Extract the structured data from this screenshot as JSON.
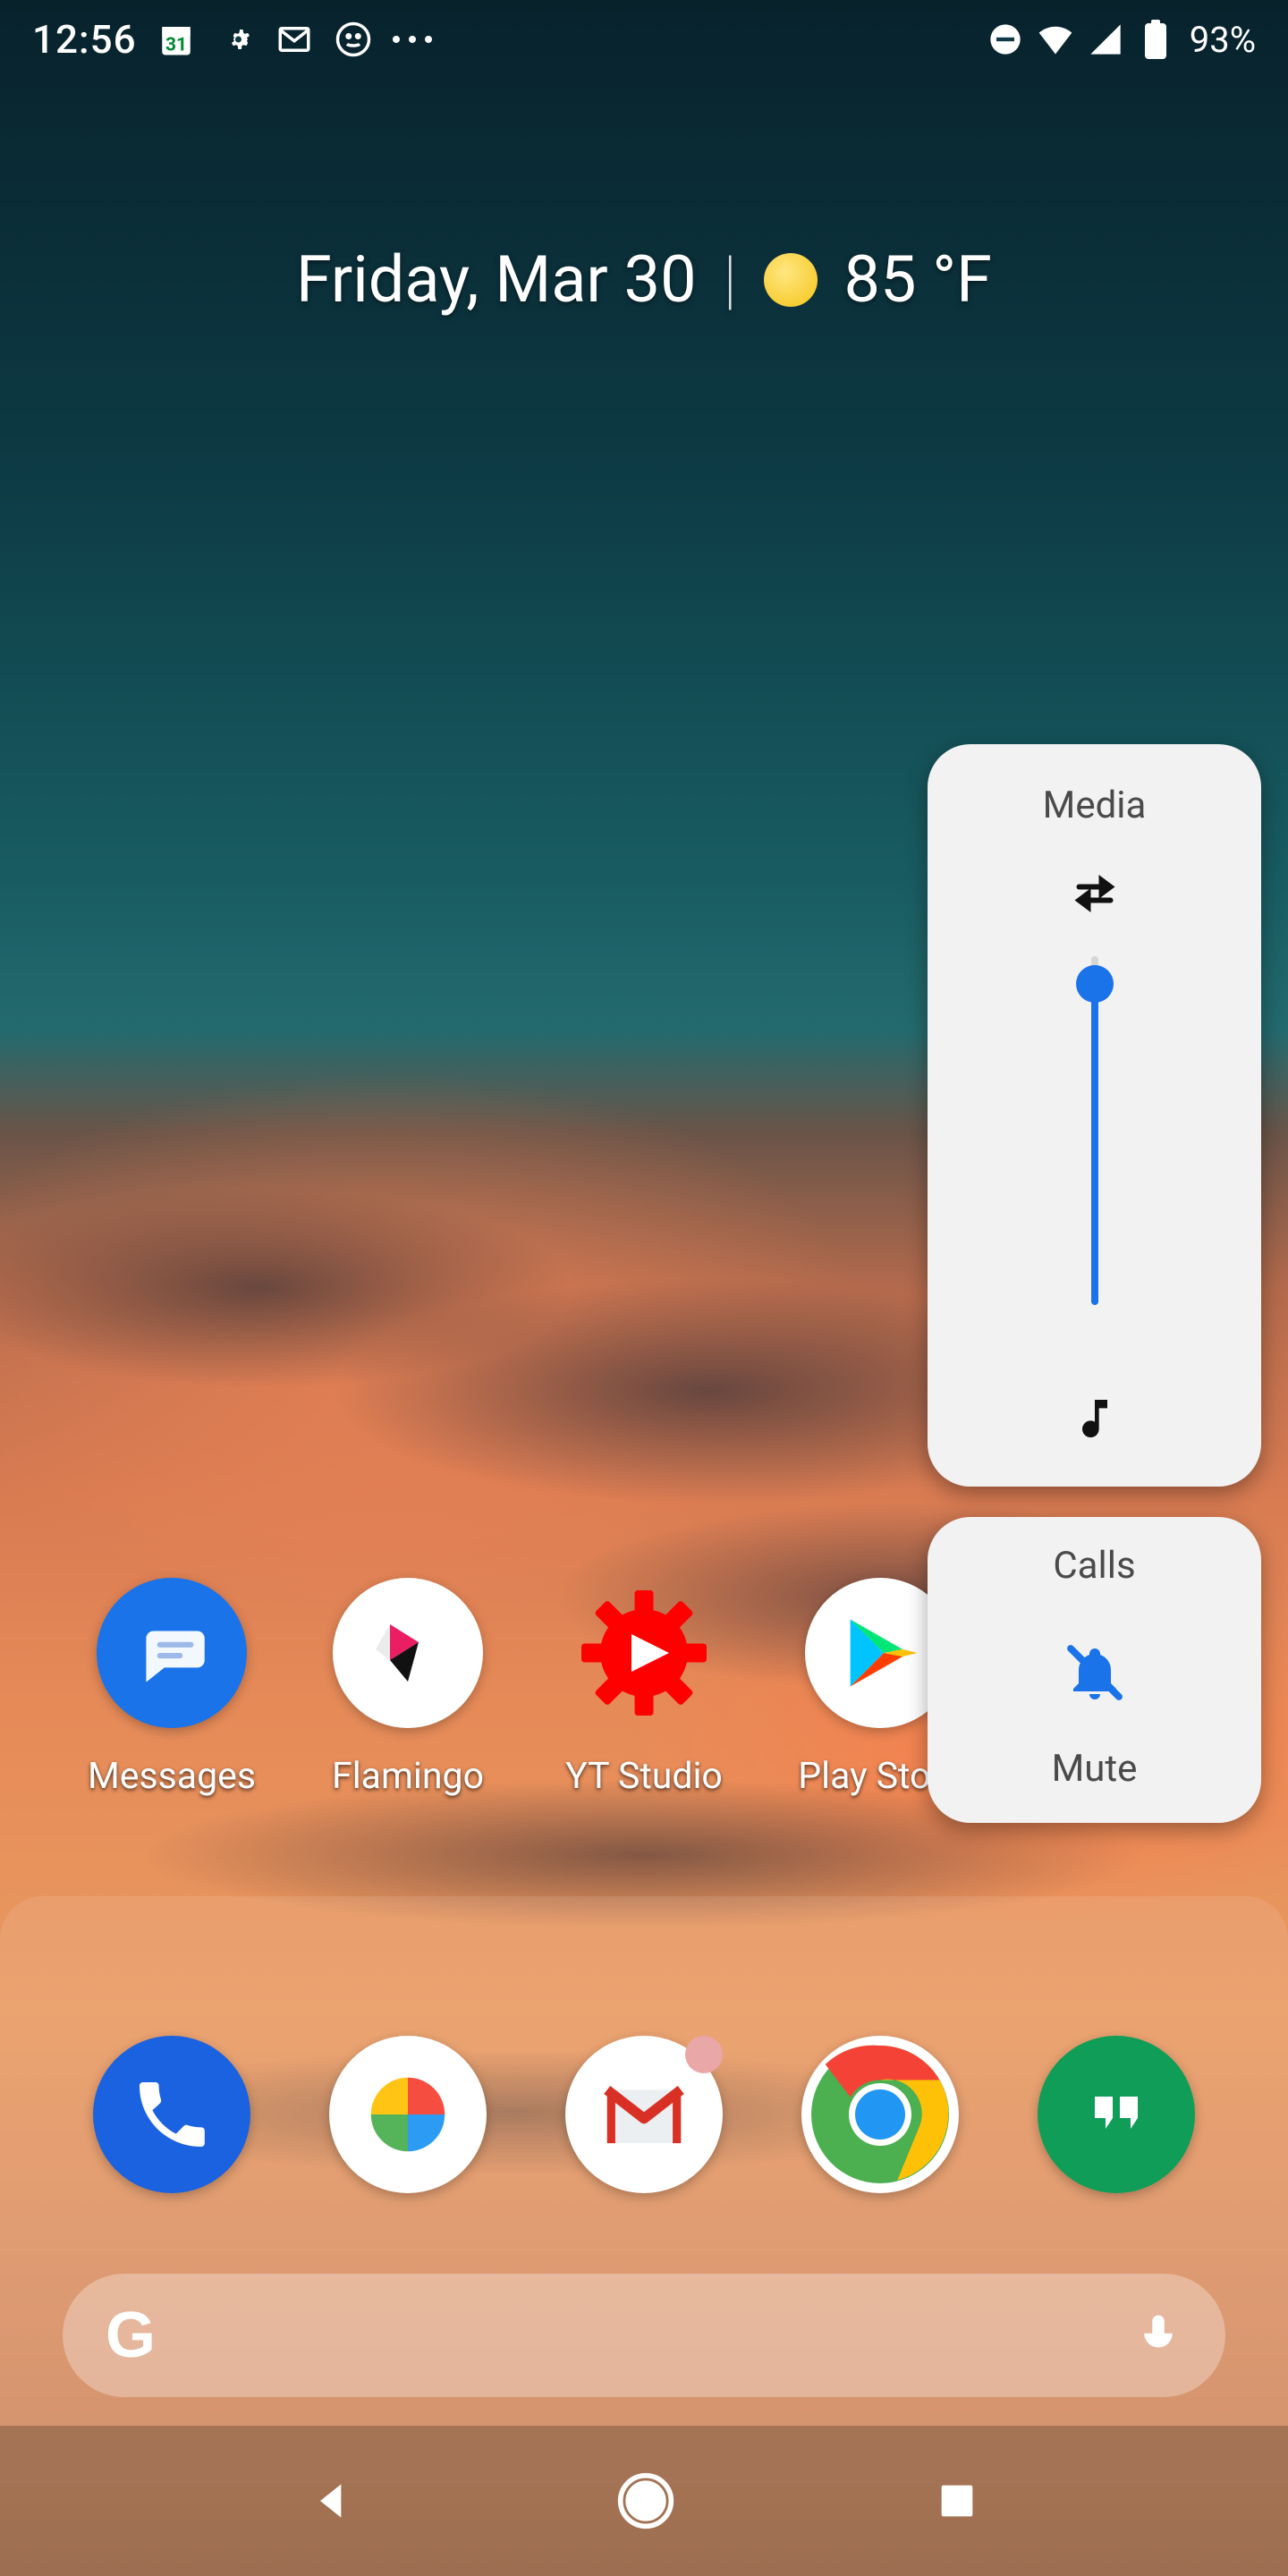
{
  "statusbar": {
    "time": "12:56",
    "battery": "93%",
    "notification_icons": [
      "calendar-icon",
      "gear-icon",
      "gmail-icon",
      "face-icon",
      "more-icon"
    ],
    "right_icons": [
      "dnd-icon",
      "wifi-icon",
      "cell-icon",
      "battery-icon"
    ]
  },
  "widget": {
    "date": "Friday, Mar 30",
    "separator": "|",
    "weather_icon": "sunny",
    "temp": "85 °F"
  },
  "home_apps": [
    {
      "name": "messages",
      "label": "Messages",
      "bg": "#1a73e8"
    },
    {
      "name": "flamingo",
      "label": "Flamingo",
      "bg": "#ffffff"
    },
    {
      "name": "yt-studio",
      "label": "YT Studio",
      "bg": "transparent"
    },
    {
      "name": "play-store",
      "label": "Play Store",
      "bg": "#ffffff"
    },
    {
      "name": "folder",
      "label": "",
      "bg": "transparent"
    }
  ],
  "dock_apps": [
    {
      "name": "phone",
      "bg": "#1a62e0"
    },
    {
      "name": "photos",
      "bg": "#ffffff"
    },
    {
      "name": "gmail",
      "bg": "#ffffff",
      "badge": true
    },
    {
      "name": "chrome",
      "bg": "#ffffff"
    },
    {
      "name": "hangouts",
      "bg": "#0f9d58"
    }
  ],
  "search": {
    "logo": "G",
    "mic": "mic-icon"
  },
  "volume_panel": {
    "media": {
      "title": "Media",
      "level_pct": 92
    },
    "calls": {
      "title": "Calls",
      "status": "Mute",
      "icon": "bell-off"
    }
  },
  "navbar": [
    "back",
    "home",
    "recents"
  ],
  "colors": {
    "accent": "#1a73e8"
  }
}
